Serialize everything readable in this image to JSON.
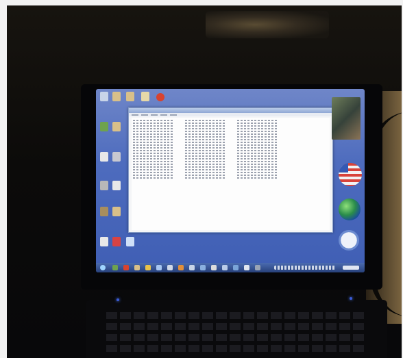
{
  "scene": {
    "description_tag": "photo-of-laptop-screen",
    "accent_colors": {
      "desktop": "#4e6cbe",
      "window": "#f4f5f7",
      "taskbar": "#27407a"
    }
  }
}
